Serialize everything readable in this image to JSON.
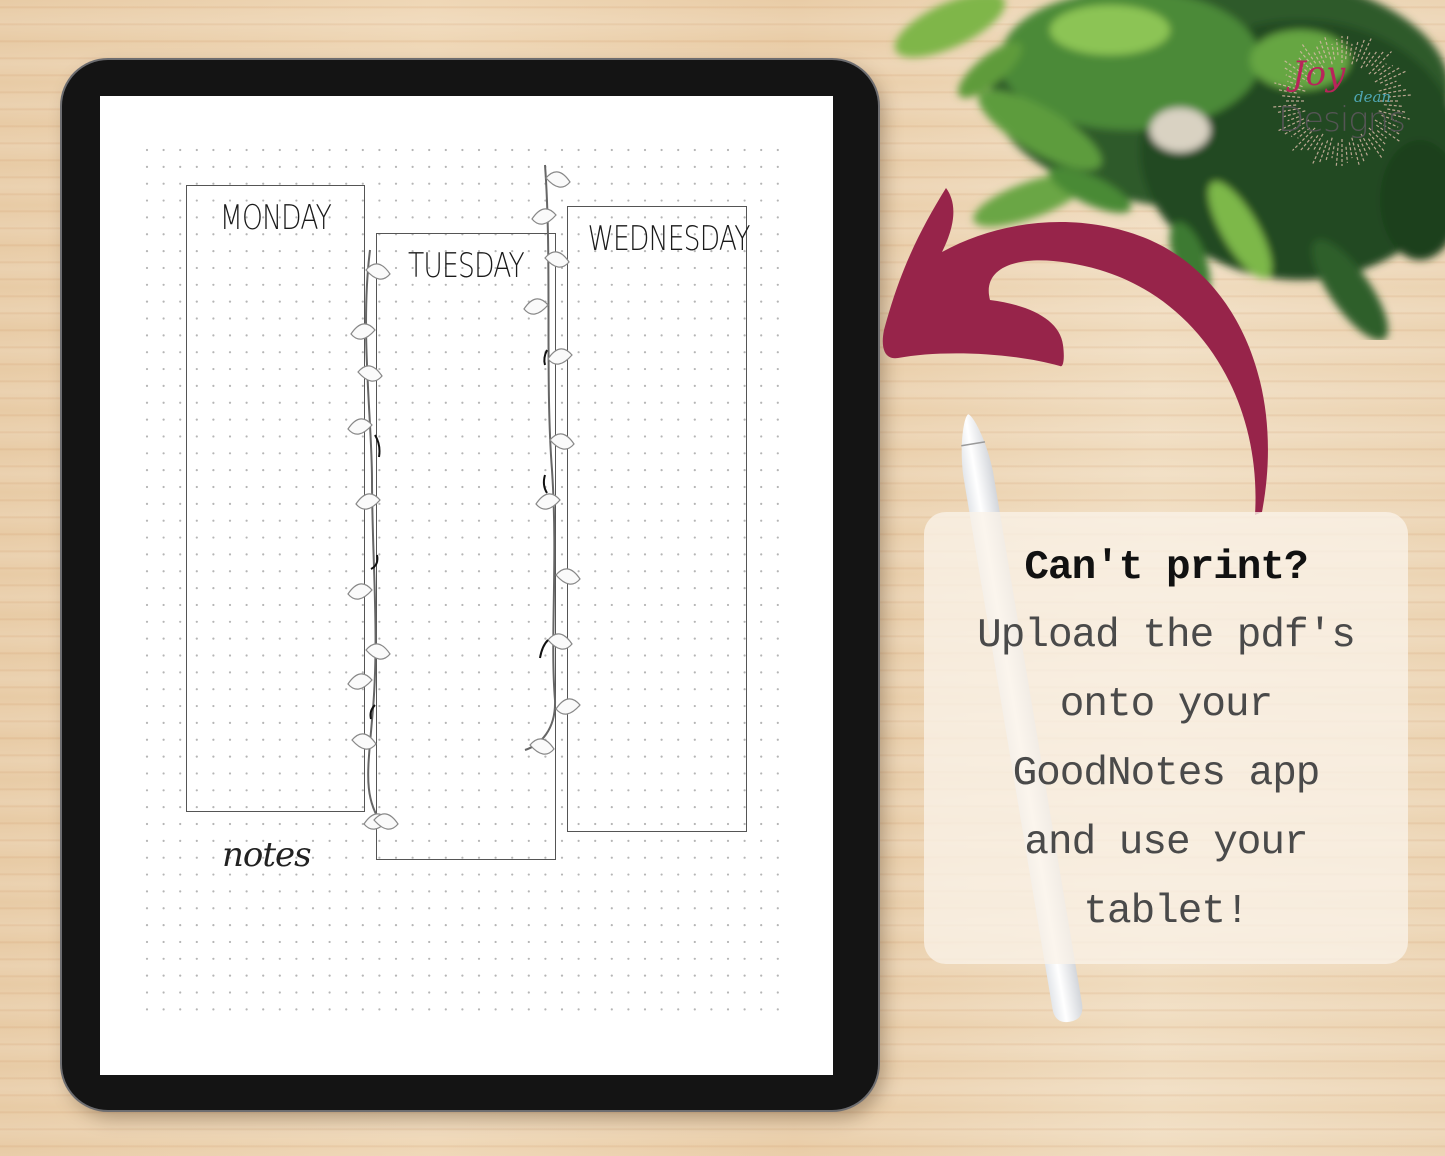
{
  "scene": {
    "description": "Digital planner mockup on tablet with callout",
    "colors": {
      "accent_arrow": "#97244A",
      "tablet_bezel": "#141414",
      "callout_heading": "#111111",
      "callout_body": "#4a4a4a",
      "logo_joy": "#b8245a",
      "logo_dean": "#4fa6b3",
      "logo_designs": "#555555"
    }
  },
  "planner": {
    "columns": [
      {
        "label": "MONDAY"
      },
      {
        "label": "TUESDAY"
      },
      {
        "label": "WEDNESDAY"
      }
    ],
    "notes_label": "notes"
  },
  "callout": {
    "heading": "Can't print?",
    "lines": [
      "Upload the pdf's",
      "onto your",
      "GoodNotes app",
      "and use your",
      "tablet!"
    ]
  },
  "logo": {
    "word1": "Joy",
    "word2": "dean",
    "word3": "Designs"
  },
  "icons": {
    "arrow": "curved-arrow-left",
    "stylus": "stylus-pencil",
    "plant": "potted-plant"
  }
}
